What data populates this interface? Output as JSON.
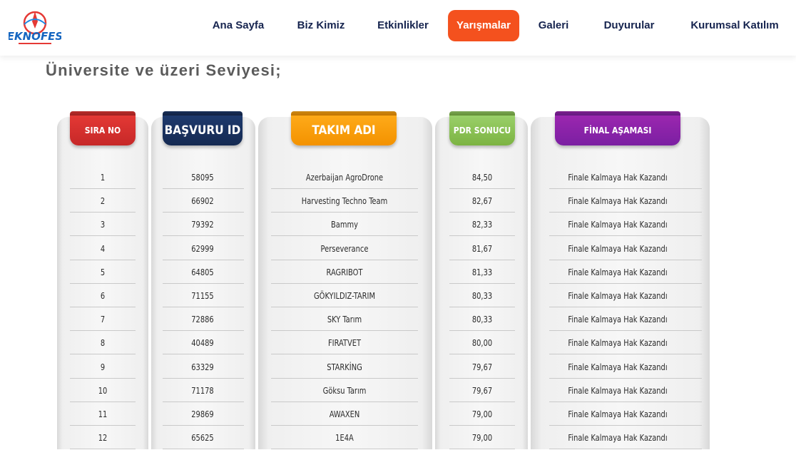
{
  "header": {
    "logo_text": "TEKNOFEST",
    "nav": [
      {
        "label": "Ana Sayfa",
        "name": "nav-ana-sayfa",
        "active": false
      },
      {
        "label": "Biz Kimiz",
        "name": "nav-biz-kimiz",
        "active": false
      },
      {
        "label": "Etkinlikler",
        "name": "nav-etkinlikler",
        "active": false
      },
      {
        "label": "Yarışmalar",
        "name": "nav-yarismalar",
        "active": true
      },
      {
        "label": "Galeri",
        "name": "nav-galeri",
        "active": false
      },
      {
        "label": "Duyurular",
        "name": "nav-duyurular",
        "active": false
      },
      {
        "label": "Kurumsal Katılım",
        "name": "nav-kurumsal-katilim",
        "active": false
      }
    ]
  },
  "section_title": "Üniversite ve üzeri Seviyesi;",
  "table": {
    "headers": {
      "sira": "SIRA NO",
      "basvuru": "BAŞVURU ID",
      "takim": "TAKIM ADI",
      "pdr": "PDR SONUCU",
      "final": "FİNAL AŞAMASI"
    },
    "rows": [
      {
        "no": "1",
        "id": "58095",
        "team": "Azerbaijan AgroDrone",
        "pdr": "84,50",
        "final": "Finale Kalmaya Hak Kazandı"
      },
      {
        "no": "2",
        "id": "66902",
        "team": "Harvesting Techno Team",
        "pdr": "82,67",
        "final": "Finale Kalmaya Hak Kazandı"
      },
      {
        "no": "3",
        "id": "79392",
        "team": "Bammy",
        "pdr": "82,33",
        "final": "Finale Kalmaya Hak Kazandı"
      },
      {
        "no": "4",
        "id": "62999",
        "team": "Perseverance",
        "pdr": "81,67",
        "final": "Finale Kalmaya Hak Kazandı"
      },
      {
        "no": "5",
        "id": "64805",
        "team": "RAGRIBOT",
        "pdr": "81,33",
        "final": "Finale Kalmaya Hak Kazandı"
      },
      {
        "no": "6",
        "id": "71155",
        "team": "GÖKYILDIZ-TARIM",
        "pdr": "80,33",
        "final": "Finale Kalmaya Hak Kazandı"
      },
      {
        "no": "7",
        "id": "72886",
        "team": "SKY Tarım",
        "pdr": "80,33",
        "final": "Finale Kalmaya Hak Kazandı"
      },
      {
        "no": "8",
        "id": "40489",
        "team": "FIRATVET",
        "pdr": "80,00",
        "final": "Finale Kalmaya Hak Kazandı"
      },
      {
        "no": "9",
        "id": "63329",
        "team": "STARKİNG",
        "pdr": "79,67",
        "final": "Finale Kalmaya Hak Kazandı"
      },
      {
        "no": "10",
        "id": "71178",
        "team": "Göksu Tarım",
        "pdr": "79,67",
        "final": "Finale Kalmaya Hak Kazandı"
      },
      {
        "no": "11",
        "id": "29869",
        "team": "AWAXEN",
        "pdr": "79,00",
        "final": "Finale Kalmaya Hak Kazandı"
      },
      {
        "no": "12",
        "id": "65625",
        "team": "1E4A",
        "pdr": "79,00",
        "final": "Finale Kalmaya Hak Kazandı"
      }
    ]
  },
  "colors": {
    "nav_text": "#16244f",
    "nav_active_bg": "#f4511e",
    "sira_header": "#d32f2f",
    "basvuru_header": "#1a3260",
    "takim_header": "#f7a10a",
    "pdr_header": "#8bc34a",
    "final_header": "#8e24aa"
  }
}
